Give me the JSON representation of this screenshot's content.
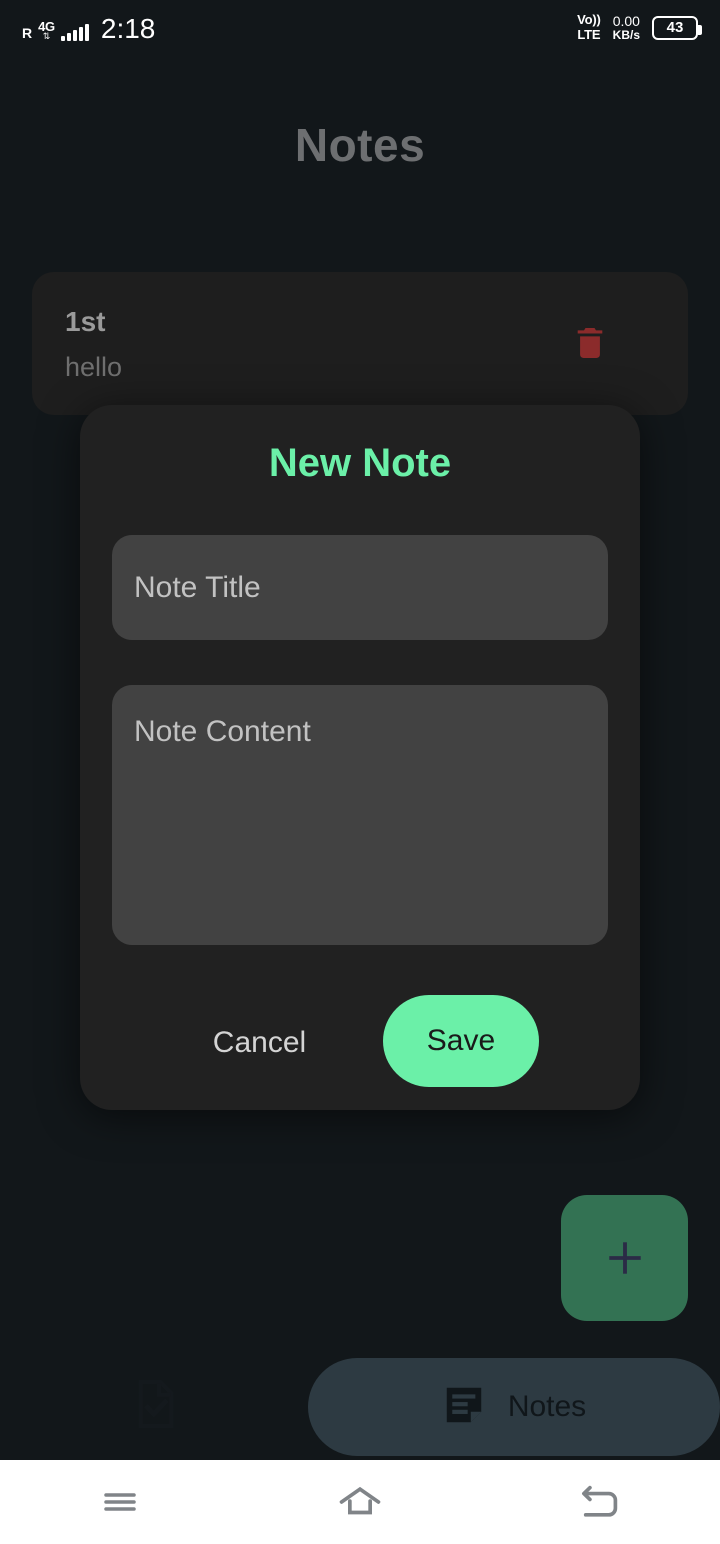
{
  "status_bar": {
    "roaming": "R",
    "network_type": "4G",
    "signal_arrows": "⇅",
    "time": "2:18",
    "volte_line1": "Vo))",
    "volte_line2": "LTE",
    "data_rate": "0.00",
    "data_unit": "KB/s",
    "battery_level": "43"
  },
  "app": {
    "title": "Notes"
  },
  "note_list": [
    {
      "title": "1st",
      "body": "hello",
      "delete_icon": "trash-icon"
    }
  ],
  "fab": {
    "icon": "plus-icon",
    "color": "#337253"
  },
  "bottom_nav": {
    "items": [
      {
        "label": "",
        "icon": "document-check-icon",
        "selected": false
      },
      {
        "label": "Notes",
        "icon": "note-icon",
        "selected": true
      }
    ],
    "selected_pill_color": "#2d3a42"
  },
  "dialog": {
    "title": "New Note",
    "title_color": "#6bf0a8",
    "title_field": {
      "value": "",
      "placeholder": "Note Title"
    },
    "content_field": {
      "value": "",
      "placeholder": "Note Content"
    },
    "cancel_label": "Cancel",
    "save_label": "Save",
    "save_color": "#6bf0a8"
  },
  "system_nav": {
    "recents_icon": "menu-icon",
    "home_icon": "home-icon",
    "back_icon": "back-icon"
  }
}
